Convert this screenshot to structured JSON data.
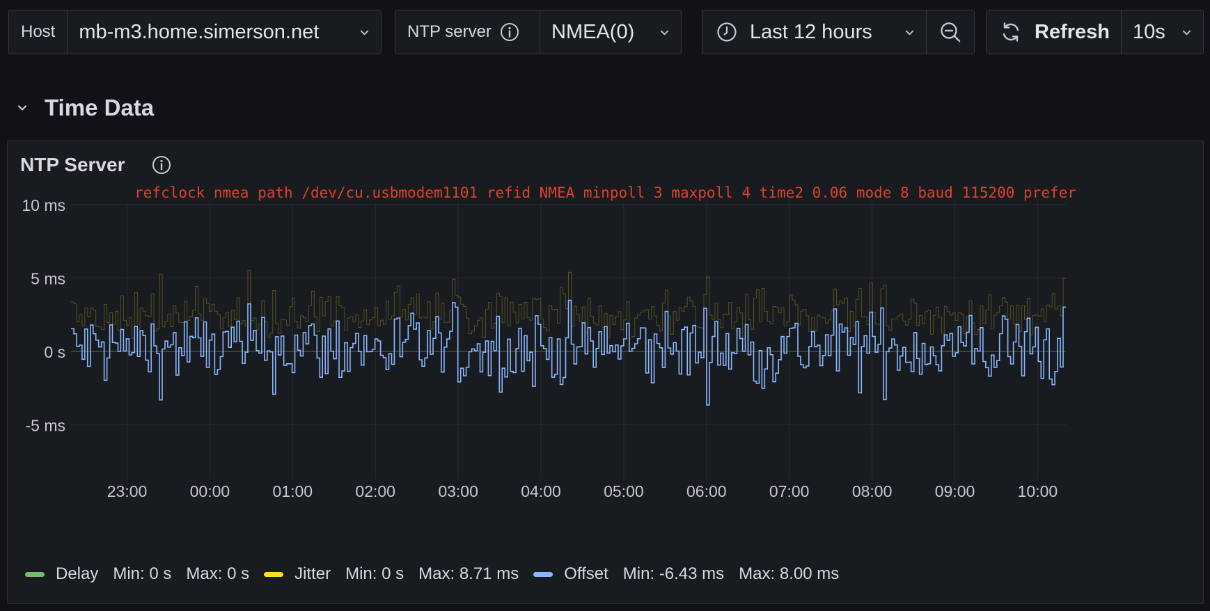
{
  "toolbar": {
    "host": {
      "label": "Host",
      "value": "mb-m3.home.simerson.net"
    },
    "ntp": {
      "label": "NTP server",
      "value": "NMEA(0)"
    },
    "time": {
      "label": "Last 12 hours"
    },
    "refresh": {
      "label": "Refresh",
      "interval": "10s"
    }
  },
  "row": {
    "title": "Time Data"
  },
  "panel": {
    "title": "NTP Server",
    "refclock": "refclock nmea path /dev/cu.usbmodem1101 refid NMEA minpoll 3 maxpoll 4 time2 0.06 mode 8 baud 115200 prefer"
  },
  "legend": [
    {
      "name": "Delay",
      "color": "#73bf69",
      "min": "Min: 0 s",
      "max": "Max: 0 s"
    },
    {
      "name": "Jitter",
      "color": "#fade2a",
      "min": "Min: 0 s",
      "max": "Max: 8.71 ms"
    },
    {
      "name": "Offset",
      "color": "#8ab8ff",
      "min": "Min: -6.43 ms",
      "max": "Max: 8.00 ms"
    }
  ],
  "chart_data": {
    "type": "line",
    "y_tick_labels": [
      "10 ms",
      "5 ms",
      "0 s",
      "-5 ms"
    ],
    "y_ticks_ms": [
      10,
      5,
      0,
      -5
    ],
    "ylim_ms": [
      -8.8,
      10.3
    ],
    "x_tick_labels": [
      "23:00",
      "00:00",
      "01:00",
      "02:00",
      "03:00",
      "04:00",
      "05:00",
      "06:00",
      "07:00",
      "08:00",
      "09:00",
      "10:00"
    ],
    "x_range_hours": [
      22.33,
      10.33
    ],
    "grid": true,
    "legend_position": "bottom-left",
    "series": [
      {
        "name": "Delay",
        "color": "#73bf69",
        "constant_ms": 0,
        "min_ms": 0,
        "max_ms": 0
      },
      {
        "name": "Jitter",
        "color": "#fade2a",
        "min_ms": 0,
        "max_ms": 8.71
      },
      {
        "name": "Offset",
        "color": "#8ab8ff",
        "min_ms": -6.43,
        "max_ms": 8.0
      }
    ]
  }
}
